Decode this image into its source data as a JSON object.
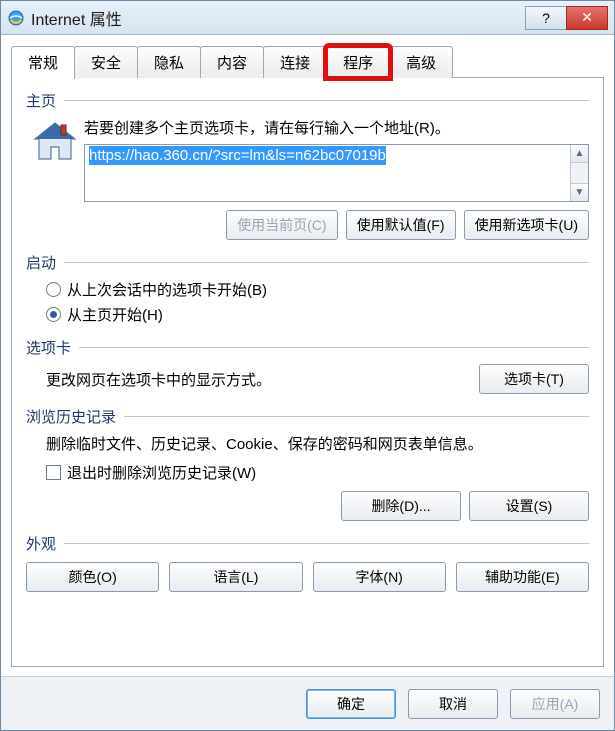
{
  "window": {
    "title": "Internet 属性"
  },
  "tabs": {
    "general": "常规",
    "security": "安全",
    "privacy": "隐私",
    "content": "内容",
    "connections": "连接",
    "programs": "程序",
    "advanced": "高级"
  },
  "homepage": {
    "title": "主页",
    "instruction": "若要创建多个主页选项卡，请在每行输入一个地址(R)。",
    "url": "https://hao.360.cn/?src=lm&ls=n62bc07019b",
    "btn_use_current": "使用当前页(C)",
    "btn_use_default": "使用默认值(F)",
    "btn_use_newtab": "使用新选项卡(U)"
  },
  "startup": {
    "title": "启动",
    "opt_last_session": "从上次会话中的选项卡开始(B)",
    "opt_homepage": "从主页开始(H)"
  },
  "tabs_section": {
    "title": "选项卡",
    "desc": "更改网页在选项卡中的显示方式。",
    "btn": "选项卡(T)"
  },
  "history": {
    "title": "浏览历史记录",
    "desc": "删除临时文件、历史记录、Cookie、保存的密码和网页表单信息。",
    "check_exit_delete": "退出时删除浏览历史记录(W)",
    "btn_delete": "删除(D)...",
    "btn_settings": "设置(S)"
  },
  "appearance": {
    "title": "外观",
    "btn_colors": "颜色(O)",
    "btn_languages": "语言(L)",
    "btn_fonts": "字体(N)",
    "btn_accessibility": "辅助功能(E)"
  },
  "footer": {
    "ok": "确定",
    "cancel": "取消",
    "apply": "应用(A)"
  }
}
